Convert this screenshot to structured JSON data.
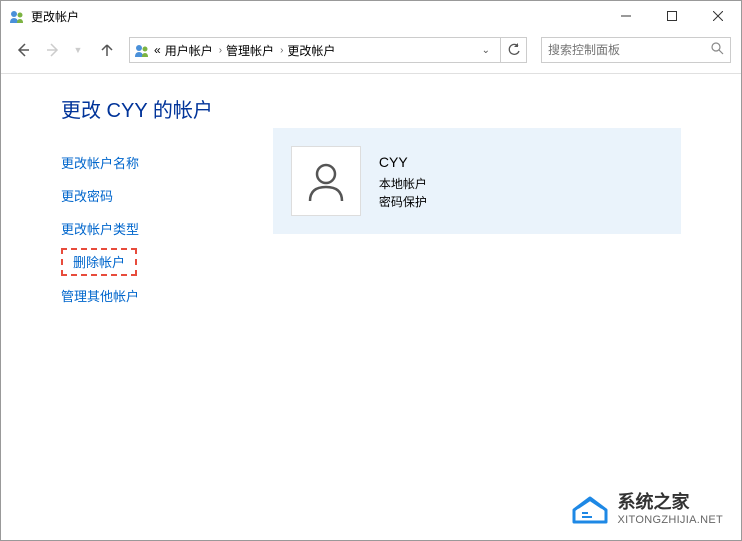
{
  "window": {
    "title": "更改帐户"
  },
  "breadcrumb": {
    "prefix": "«",
    "items": [
      "用户帐户",
      "管理帐户",
      "更改帐户"
    ]
  },
  "search": {
    "placeholder": "搜索控制面板"
  },
  "page": {
    "title": "更改 CYY 的帐户"
  },
  "actions": {
    "changeName": "更改帐户名称",
    "changePassword": "更改密码",
    "changeType": "更改帐户类型",
    "deleteAccount": "删除帐户",
    "manageOthers": "管理其他帐户"
  },
  "account": {
    "name": "CYY",
    "type": "本地帐户",
    "protection": "密码保护"
  },
  "watermark": {
    "main": "系统之家",
    "sub": "XITONGZHIJIA.NET"
  }
}
